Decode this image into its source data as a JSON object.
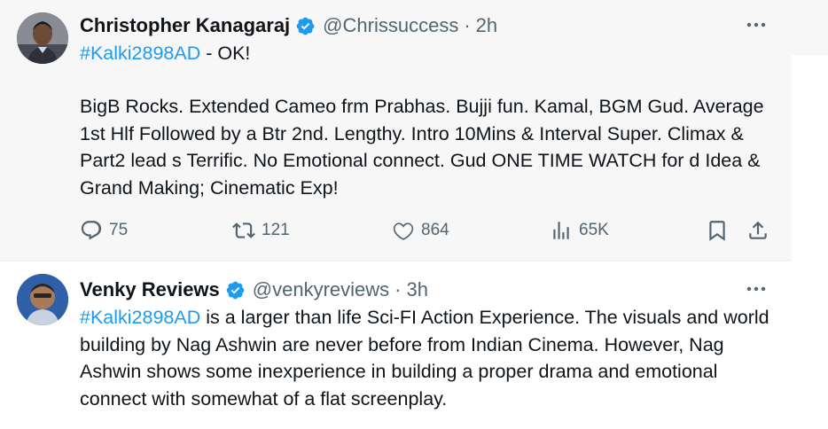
{
  "tweets": [
    {
      "author_name": "Christopher Kanagaraj",
      "handle": "@Chrissuccess",
      "separator": "·",
      "time": "2h",
      "hashtag": "#Kalki2898AD",
      "first_line_rest": " - OK!",
      "paragraph": "BigB Rocks. Extended Cameo frm Prabhas. Bujji fun. Kamal, BGM Gud. Average 1st Hlf Followed by a Btr 2nd. Lengthy. Intro 10Mins & Interval Super. Climax & Part2 lead s Terrific. No Emotional connect. Gud ONE TIME WATCH for d Idea & Grand Making; Cinematic Exp!",
      "replies": "75",
      "reposts": "121",
      "likes": "864",
      "views": "65K"
    },
    {
      "author_name": "Venky Reviews",
      "handle": "@venkyreviews",
      "separator": "·",
      "time": "3h",
      "hashtag": "#Kalki2898AD",
      "text_rest": " is a larger than life Sci-FI Action Experience. The visuals and world building by Nag Ashwin are never before from Indian Cinema. However, Nag Ashwin shows some inexperience in building a proper drama and emotional connect with somewhat of a flat screenplay."
    }
  ],
  "colors": {
    "accent": "#1d9bf0",
    "text": "#0f1419",
    "secondary": "#536471",
    "highlight_bg": "#f7f7f7"
  },
  "icons": [
    "verified-badge-icon",
    "more-options-icon",
    "reply-icon",
    "repost-icon",
    "like-icon",
    "views-icon",
    "bookmark-icon",
    "share-icon"
  ]
}
